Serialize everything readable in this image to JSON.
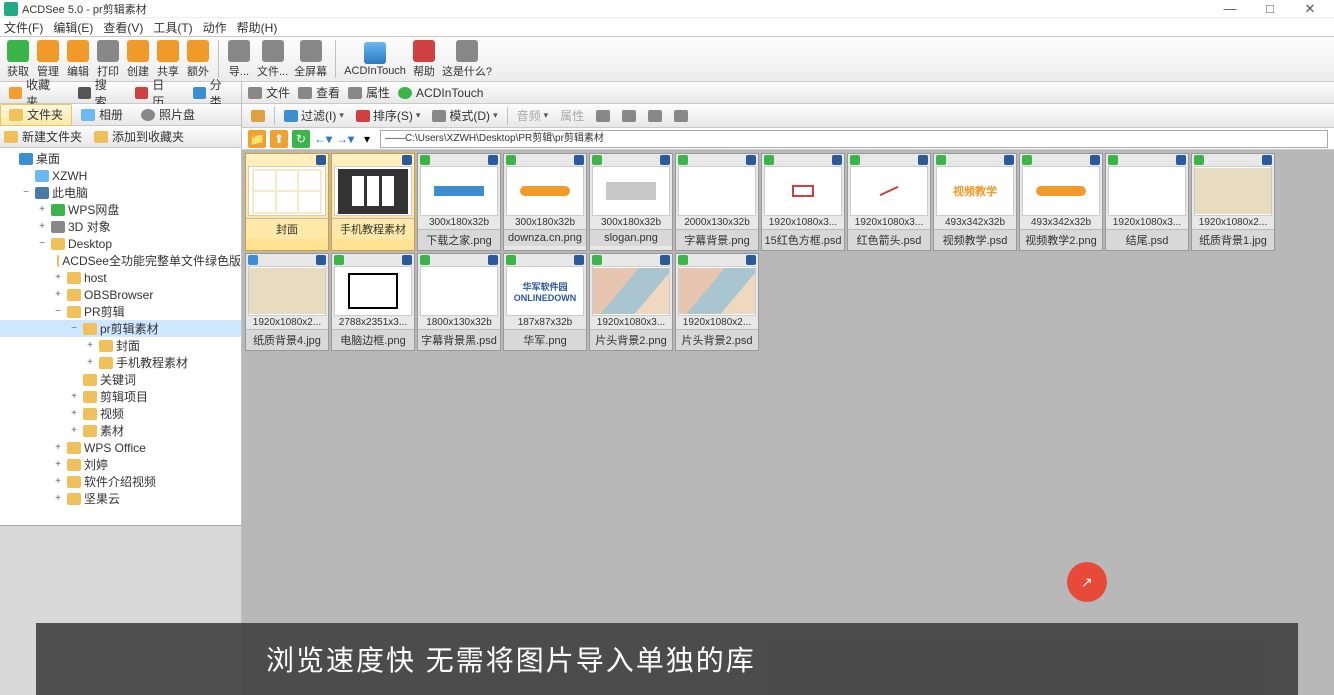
{
  "window": {
    "title": "ACDSee 5.0 - pr剪辑素材",
    "btn_min": "—",
    "btn_max": "□",
    "btn_close": "✕"
  },
  "menu": [
    "文件(F)",
    "编辑(E)",
    "查看(V)",
    "工具(T)",
    "动作",
    "帮助(H)"
  ],
  "toolbar1": {
    "items": [
      "获取",
      "管理",
      "编辑",
      "打印",
      "创建",
      "共享",
      "额外"
    ],
    "items2": [
      "导...",
      "文件...",
      "全屏幕"
    ],
    "items3": [
      "ACDInTouch",
      "帮助",
      "这是什么?"
    ]
  },
  "left_tabs1": [
    {
      "icon": "ti-fav",
      "label": "收藏夹"
    },
    {
      "icon": "ti-search",
      "label": "搜索"
    },
    {
      "icon": "ti-cal",
      "label": "日历"
    },
    {
      "icon": "ti-cat",
      "label": "分类"
    }
  ],
  "left_tabs2": [
    {
      "icon": "ti-folder",
      "label": "文件夹",
      "active": true
    },
    {
      "icon": "ti-album",
      "label": "相册"
    },
    {
      "icon": "ti-disc",
      "label": "照片盘"
    }
  ],
  "left_actions": [
    {
      "label": "新建文件夹"
    },
    {
      "label": "添加到收藏夹"
    }
  ],
  "tree": [
    {
      "indent": 0,
      "exp": "",
      "icon": "ni-desktop",
      "label": "桌面"
    },
    {
      "indent": 1,
      "exp": "",
      "icon": "ni-user",
      "label": "XZWH"
    },
    {
      "indent": 1,
      "exp": "−",
      "icon": "ni-pc",
      "label": "此电脑"
    },
    {
      "indent": 2,
      "exp": "+",
      "icon": "ni-cloud",
      "label": "WPS网盘"
    },
    {
      "indent": 2,
      "exp": "+",
      "icon": "ni-3d",
      "label": "3D 对象"
    },
    {
      "indent": 2,
      "exp": "−",
      "icon": "ni-folder",
      "label": "Desktop"
    },
    {
      "indent": 3,
      "exp": "",
      "icon": "ni-folder",
      "label": "ACDSee全功能完整单文件绿色版"
    },
    {
      "indent": 3,
      "exp": "+",
      "icon": "ni-folder",
      "label": "host"
    },
    {
      "indent": 3,
      "exp": "+",
      "icon": "ni-folder",
      "label": "OBSBrowser"
    },
    {
      "indent": 3,
      "exp": "−",
      "icon": "ni-folder",
      "label": "PR剪辑"
    },
    {
      "indent": 4,
      "exp": "−",
      "icon": "ni-folder",
      "label": "pr剪辑素材",
      "sel": true
    },
    {
      "indent": 5,
      "exp": "+",
      "icon": "ni-folder",
      "label": "封面"
    },
    {
      "indent": 5,
      "exp": "+",
      "icon": "ni-folder",
      "label": "手机教程素材"
    },
    {
      "indent": 4,
      "exp": "",
      "icon": "ni-folder",
      "label": "关键词"
    },
    {
      "indent": 4,
      "exp": "+",
      "icon": "ni-folder",
      "label": "剪辑项目"
    },
    {
      "indent": 4,
      "exp": "+",
      "icon": "ni-folder",
      "label": "视频"
    },
    {
      "indent": 4,
      "exp": "+",
      "icon": "ni-folder",
      "label": "素材"
    },
    {
      "indent": 3,
      "exp": "+",
      "icon": "ni-folder",
      "label": "WPS Office"
    },
    {
      "indent": 3,
      "exp": "+",
      "icon": "ni-folder",
      "label": "刘婷"
    },
    {
      "indent": 3,
      "exp": "+",
      "icon": "ni-folder",
      "label": "软件介绍视频"
    },
    {
      "indent": 3,
      "exp": "+",
      "icon": "ni-folder",
      "label": "坚果云"
    }
  ],
  "right_tabs": [
    {
      "label": "文件"
    },
    {
      "label": "查看"
    },
    {
      "label": "属性"
    },
    {
      "label": "ACDInTouch"
    }
  ],
  "right_tools": {
    "filter": "过滤(I)",
    "sort": "排序(S)",
    "mode": "模式(D)",
    "audio": "音频",
    "props": "属性"
  },
  "path": "——C:\\Users\\XZWH\\Desktop\\PR剪辑\\pr剪辑素材",
  "thumbs": [
    {
      "dims": "",
      "name": "封面",
      "pv": "grid",
      "folder": true,
      "sel": true
    },
    {
      "dims": "",
      "name": "手机教程素材",
      "pv": "phone",
      "folder": true,
      "sel": true
    },
    {
      "dims": "300x180x32b",
      "name": "下载之家.png",
      "pv": "blue"
    },
    {
      "dims": "300x180x32b",
      "name": "downza.cn.png",
      "pv": "orange"
    },
    {
      "dims": "300x180x32b",
      "name": "slogan.png",
      "pv": "gray"
    },
    {
      "dims": "2000x130x32b",
      "name": "字幕背景.png",
      "pv": "empty"
    },
    {
      "dims": "1920x1080x3...",
      "name": "15红色方框.psd",
      "pv": "redbox"
    },
    {
      "dims": "1920x1080x3...",
      "name": "红色箭头.psd",
      "pv": "redarrow"
    },
    {
      "dims": "493x342x32b",
      "name": "视频教学.psd",
      "pv": "text",
      "text": "视频教学"
    },
    {
      "dims": "493x342x32b",
      "name": "视频教学2.png",
      "pv": "orange"
    },
    {
      "dims": "1920x1080x3...",
      "name": "结尾.psd",
      "pv": "empty"
    },
    {
      "dims": "1920x1080x2...",
      "name": "纸质背景1.jpg",
      "pv": "beige"
    },
    {
      "dims": "1920x1080x2...",
      "name": "纸质背景4.jpg",
      "pv": "beige",
      "info": true
    },
    {
      "dims": "2788x2351x3...",
      "name": "电脑边框.png",
      "pv": "monitor"
    },
    {
      "dims": "1800x130x32b",
      "name": "字幕背景黑.psd",
      "pv": "empty"
    },
    {
      "dims": "187x87x32b",
      "name": "华军.png",
      "pv": "logo",
      "text": "ONLINEDOWN"
    },
    {
      "dims": "1920x1080x3...",
      "name": "片头背景2.png",
      "pv": "waves"
    },
    {
      "dims": "1920x1080x2...",
      "name": "片头背景2.psd",
      "pv": "waves"
    }
  ],
  "subtitle": "浏览速度快 无需将图片导入单独的库"
}
